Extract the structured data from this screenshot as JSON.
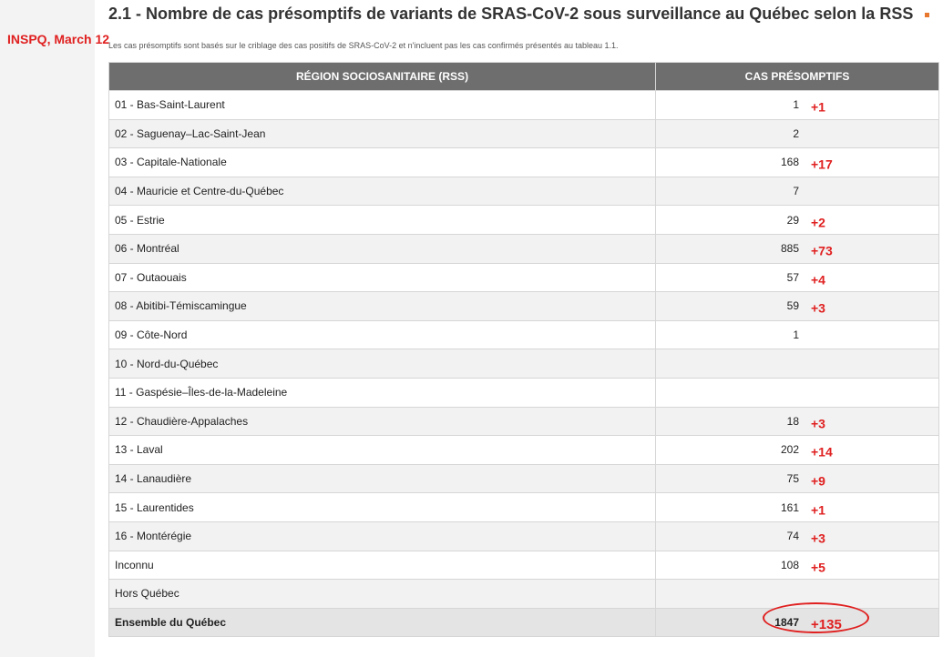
{
  "annotation": "INSPQ, March 12",
  "title": {
    "number": "2.1",
    "text": "- Nombre de cas présomptifs de variants de SRAS-CoV-2 sous surveillance au Québec selon la RSS"
  },
  "subtitle": "Les cas présomptifs sont basés sur le criblage des cas positifs de SRAS-CoV-2 et n'incluent pas les cas confirmés présentés au tableau 1.1.",
  "table": {
    "headers": [
      "RÉGION SOCIOSANITAIRE (RSS)",
      "CAS PRÉSOMPTIFS"
    ],
    "rows": [
      {
        "region": "01 - Bas-Saint-Laurent",
        "cases": "1",
        "delta": "+1"
      },
      {
        "region": "02 - Saguenay–Lac-Saint-Jean",
        "cases": "2",
        "delta": ""
      },
      {
        "region": "03 - Capitale-Nationale",
        "cases": "168",
        "delta": "+17"
      },
      {
        "region": "04 - Mauricie et Centre-du-Québec",
        "cases": "7",
        "delta": ""
      },
      {
        "region": "05 - Estrie",
        "cases": "29",
        "delta": "+2"
      },
      {
        "region": "06 - Montréal",
        "cases": "885",
        "delta": "+73"
      },
      {
        "region": "07 - Outaouais",
        "cases": "57",
        "delta": "+4"
      },
      {
        "region": "08 - Abitibi-Témiscamingue",
        "cases": "59",
        "delta": "+3"
      },
      {
        "region": "09 - Côte-Nord",
        "cases": "1",
        "delta": ""
      },
      {
        "region": "10 - Nord-du-Québec",
        "cases": "",
        "delta": ""
      },
      {
        "region": "11 - Gaspésie–Îles-de-la-Madeleine",
        "cases": "",
        "delta": ""
      },
      {
        "region": "12 - Chaudière-Appalaches",
        "cases": "18",
        "delta": "+3"
      },
      {
        "region": "13 - Laval",
        "cases": "202",
        "delta": "+14"
      },
      {
        "region": "14 - Lanaudière",
        "cases": "75",
        "delta": "+9"
      },
      {
        "region": "15 - Laurentides",
        "cases": "161",
        "delta": "+1"
      },
      {
        "region": "16 - Montérégie",
        "cases": "74",
        "delta": "+3"
      },
      {
        "region": "Inconnu",
        "cases": "108",
        "delta": "+5"
      },
      {
        "region": "Hors Québec",
        "cases": "",
        "delta": ""
      }
    ],
    "total": {
      "region": "Ensemble du Québec",
      "cases": "1847",
      "delta": "+135"
    }
  },
  "colors": {
    "header_bg": "#6e6e6e",
    "annotation_red": "#e02020",
    "title_marker": "#e8772e",
    "row_alt": "#f2f2f2"
  }
}
